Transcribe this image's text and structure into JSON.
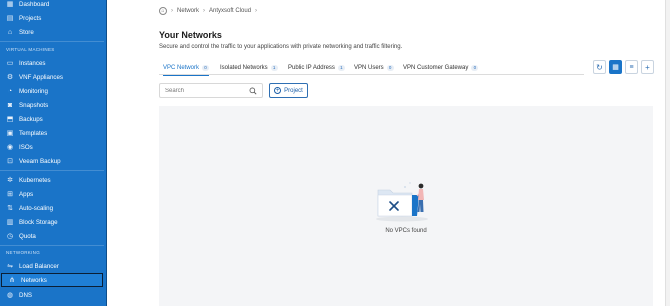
{
  "sidebar": {
    "top_items": [
      {
        "label": "Dashboard",
        "icon": "dashboard-icon"
      },
      {
        "label": "Projects",
        "icon": "projects-icon"
      },
      {
        "label": "Store",
        "icon": "store-icon"
      }
    ],
    "section_vm": "VIRTUAL MACHINES",
    "vm_items": [
      {
        "label": "Instances",
        "icon": "instances-icon"
      },
      {
        "label": "VNF Appliances",
        "icon": "vnf-icon"
      },
      {
        "label": "Monitoring",
        "icon": "monitoring-icon"
      },
      {
        "label": "Snapshots",
        "icon": "snapshots-icon"
      },
      {
        "label": "Backups",
        "icon": "backups-icon"
      },
      {
        "label": "Templates",
        "icon": "templates-icon"
      },
      {
        "label": "ISOs",
        "icon": "iso-icon"
      },
      {
        "label": "Veeam Backup",
        "icon": "veeam-icon"
      }
    ],
    "k8s_items": [
      {
        "label": "Kubernetes",
        "icon": "kubernetes-icon"
      },
      {
        "label": "Apps",
        "icon": "apps-icon"
      },
      {
        "label": "Auto-scaling",
        "icon": "autoscaling-icon"
      },
      {
        "label": "Block Storage",
        "icon": "block-storage-icon"
      },
      {
        "label": "Quota",
        "icon": "quota-icon"
      }
    ],
    "section_net": "NETWORKING",
    "net_items": [
      {
        "label": "Load Balancer",
        "icon": "load-balancer-icon"
      },
      {
        "label": "Networks",
        "icon": "networks-icon",
        "active": true
      },
      {
        "label": "DNS",
        "icon": "dns-icon"
      }
    ]
  },
  "breadcrumb": {
    "home_icon": "home-icon",
    "items": [
      "Network",
      "Antyxsoft Cloud"
    ]
  },
  "page": {
    "title": "Your Networks",
    "description": "Secure and control the traffic to your applications with private networking and traffic filtering."
  },
  "tabs": [
    {
      "label": "VPC Network",
      "count": "0",
      "active": true
    },
    {
      "label": "Isolated Networks",
      "count": "1"
    },
    {
      "label": "Public IP Address",
      "count": "1"
    },
    {
      "label": "VPN Users",
      "count": "0"
    },
    {
      "label": "VPN Customer Gateway",
      "count": "0"
    }
  ],
  "toolbar": {
    "refresh_icon": "refresh-icon",
    "grid_icon": "grid-view-icon",
    "list_icon": "list-view-icon",
    "add_icon": "add-icon"
  },
  "search": {
    "placeholder": "Search",
    "value": ""
  },
  "project_button": {
    "label": "Project"
  },
  "empty": {
    "text": "No VPCs found"
  },
  "colors": {
    "sidebar": "#1a74c8",
    "accent": "#1a74c8",
    "panel": "#f4f5f7"
  }
}
